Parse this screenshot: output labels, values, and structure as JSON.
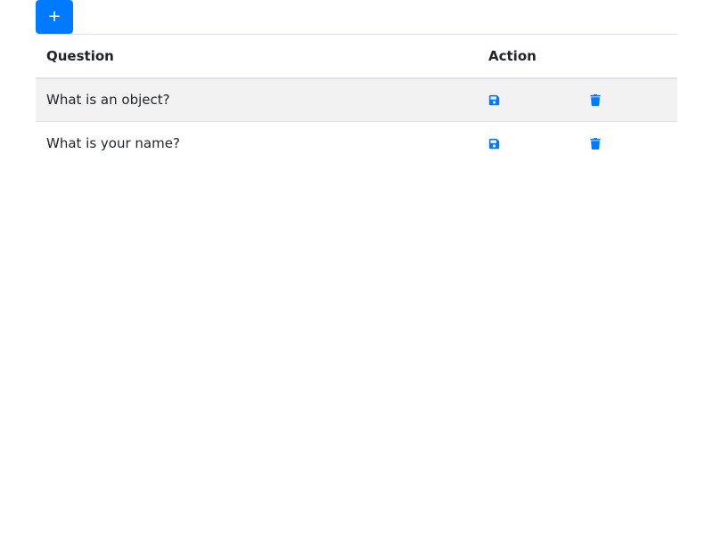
{
  "toolbar": {
    "add_label": "+"
  },
  "table": {
    "headers": {
      "question": "Question",
      "action": "Action"
    },
    "rows": [
      {
        "question": "What is an object?",
        "save_icon": "floppy-disk-icon",
        "delete_icon": "trash-icon"
      },
      {
        "question": "What is your name?",
        "save_icon": "floppy-disk-icon",
        "delete_icon": "trash-icon"
      }
    ]
  },
  "colors": {
    "accent": "#007bff",
    "stripe": "#f2f2f2",
    "border": "#dee2e6"
  }
}
